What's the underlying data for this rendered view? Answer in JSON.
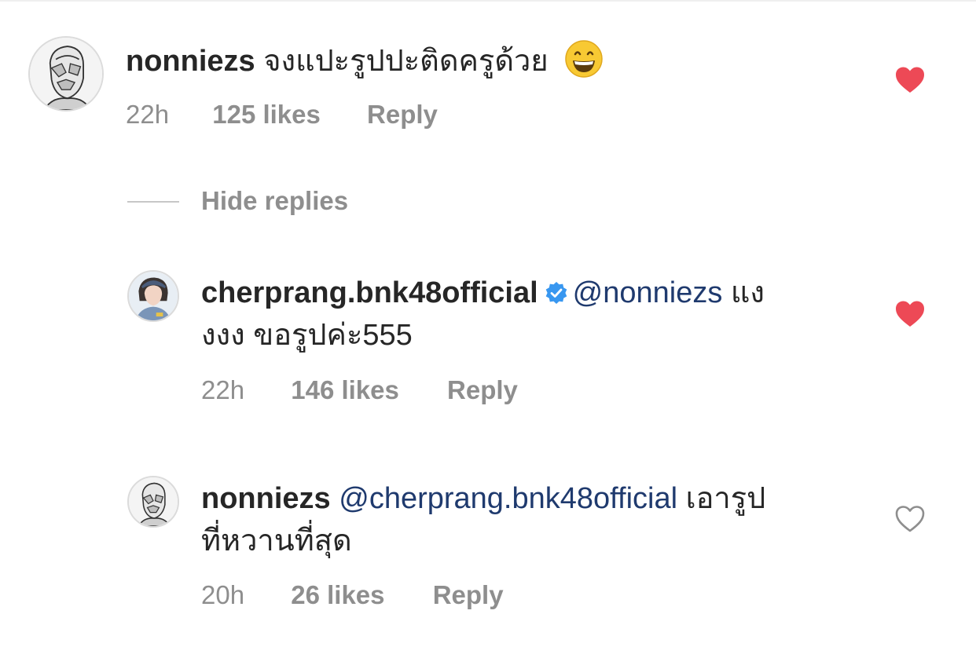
{
  "comments": [
    {
      "username": "nonniezs",
      "mention": "",
      "text": "จงแปะรูปปะติดครูด้วย",
      "emoji": "grinning-face-emoji",
      "time": "22h",
      "likes": "125 likes",
      "reply": "Reply",
      "liked": true
    }
  ],
  "thread": {
    "hide_replies": "Hide replies",
    "replies": [
      {
        "username": "cherprang.bnk48official",
        "verified": true,
        "mention": "@nonniezs",
        "text_line1": "แง",
        "text_line2": "งงง ขอรูปค่ะ555",
        "time": "22h",
        "likes": "146 likes",
        "reply": "Reply",
        "liked": true
      },
      {
        "username": "nonniezs",
        "verified": false,
        "mention": "@cherprang.bnk48official",
        "text_line1": "เอารูป",
        "text_line2": "ที่หวานที่สุด",
        "time": "20h",
        "likes": "26 likes",
        "reply": "Reply",
        "liked": false
      }
    ]
  },
  "colors": {
    "heart_liked": "#ed4956",
    "heart_outline": "#8e8e8e",
    "mention": "#1f3a6e",
    "meta": "#8e8e8e",
    "verified": "#3897f0"
  }
}
